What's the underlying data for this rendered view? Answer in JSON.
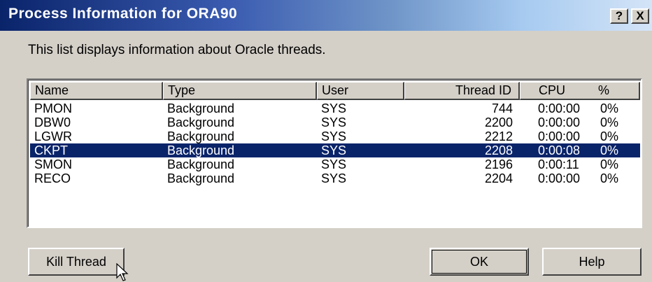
{
  "window": {
    "title": "Process Information for ORA90",
    "help_glyph": "?",
    "close_glyph": "X"
  },
  "description": "This list displays information about Oracle threads.",
  "list": {
    "columns": {
      "name": "Name",
      "type": "Type",
      "user": "User",
      "thread_id": "Thread ID",
      "cpu": "CPU",
      "pct": "%"
    },
    "rows": [
      {
        "name": "PMON",
        "type": "Background",
        "user": "SYS",
        "thread_id": "744",
        "cpu": "0:00:00",
        "pct": "0%",
        "selected": false
      },
      {
        "name": "DBW0",
        "type": "Background",
        "user": "SYS",
        "thread_id": "2200",
        "cpu": "0:00:00",
        "pct": "0%",
        "selected": false
      },
      {
        "name": "LGWR",
        "type": "Background",
        "user": "SYS",
        "thread_id": "2212",
        "cpu": "0:00:00",
        "pct": "0%",
        "selected": false
      },
      {
        "name": "CKPT",
        "type": "Background",
        "user": "SYS",
        "thread_id": "2208",
        "cpu": "0:00:08",
        "pct": "0%",
        "selected": true
      },
      {
        "name": "SMON",
        "type": "Background",
        "user": "SYS",
        "thread_id": "2196",
        "cpu": "0:00:11",
        "pct": "0%",
        "selected": false
      },
      {
        "name": "RECO",
        "type": "Background",
        "user": "SYS",
        "thread_id": "2204",
        "cpu": "0:00:00",
        "pct": "0%",
        "selected": false
      }
    ]
  },
  "buttons": {
    "kill": "Kill Thread",
    "ok": "OK",
    "help": "Help"
  },
  "colors": {
    "selection": "#0a246a",
    "face": "#d4d0c8"
  }
}
